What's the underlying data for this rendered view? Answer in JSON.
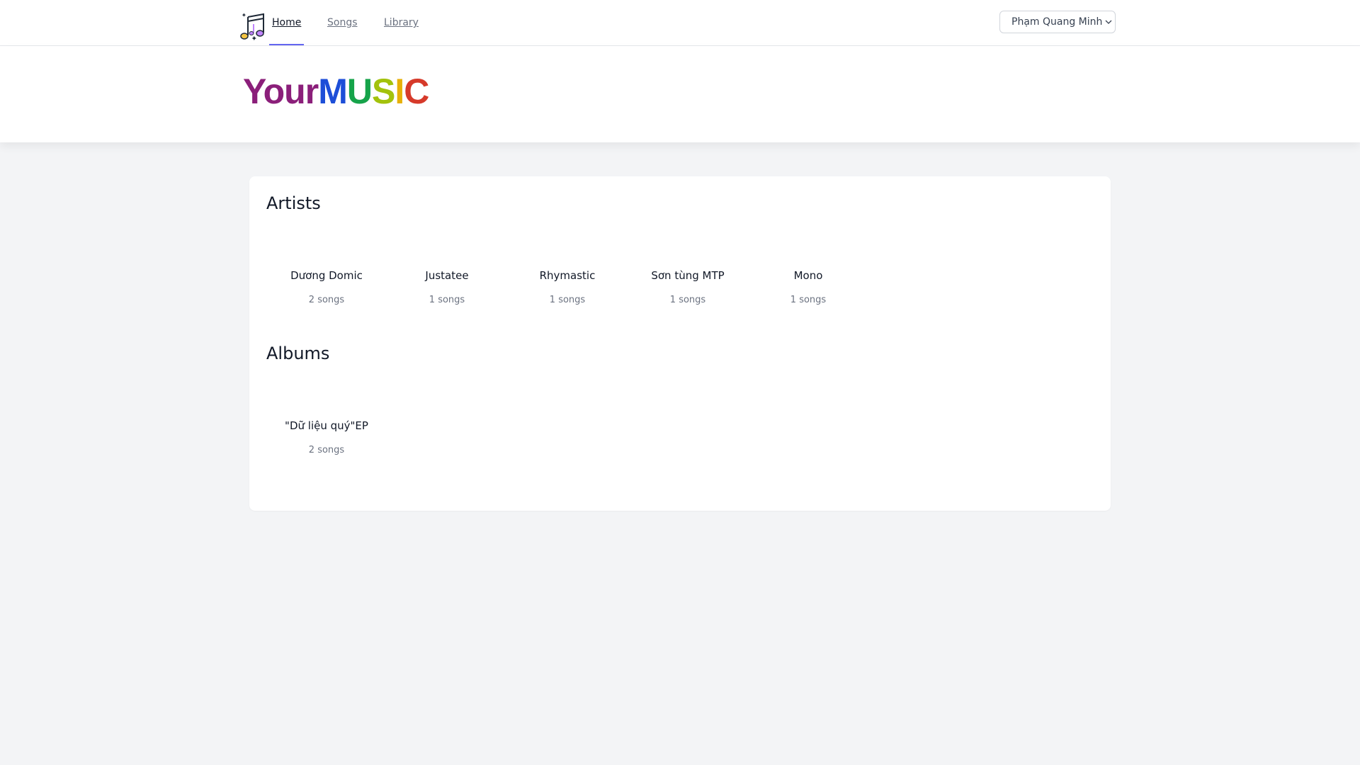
{
  "nav": {
    "links": [
      {
        "label": "Home",
        "active": true
      },
      {
        "label": "Songs",
        "active": false
      },
      {
        "label": "Library",
        "active": false
      }
    ],
    "user_name": "Phạm Quang Minh"
  },
  "brand": {
    "prefix": "Your",
    "letters": [
      "M",
      "U",
      "S",
      "I",
      "C"
    ]
  },
  "artists": {
    "title": "Artists",
    "items": [
      {
        "name": "Dương Domic",
        "count": "2 songs"
      },
      {
        "name": "Justatee",
        "count": "1 songs"
      },
      {
        "name": "Rhymastic",
        "count": "1 songs"
      },
      {
        "name": "Sơn tùng MTP",
        "count": "1 songs"
      },
      {
        "name": "Mono",
        "count": "1 songs"
      }
    ]
  },
  "albums": {
    "title": "Albums",
    "items": [
      {
        "name": "\"Dữ liệu quý\"EP",
        "count": "2 songs"
      }
    ]
  },
  "colors": {
    "accent": "#6366f1",
    "background": "#f3f4f6"
  }
}
